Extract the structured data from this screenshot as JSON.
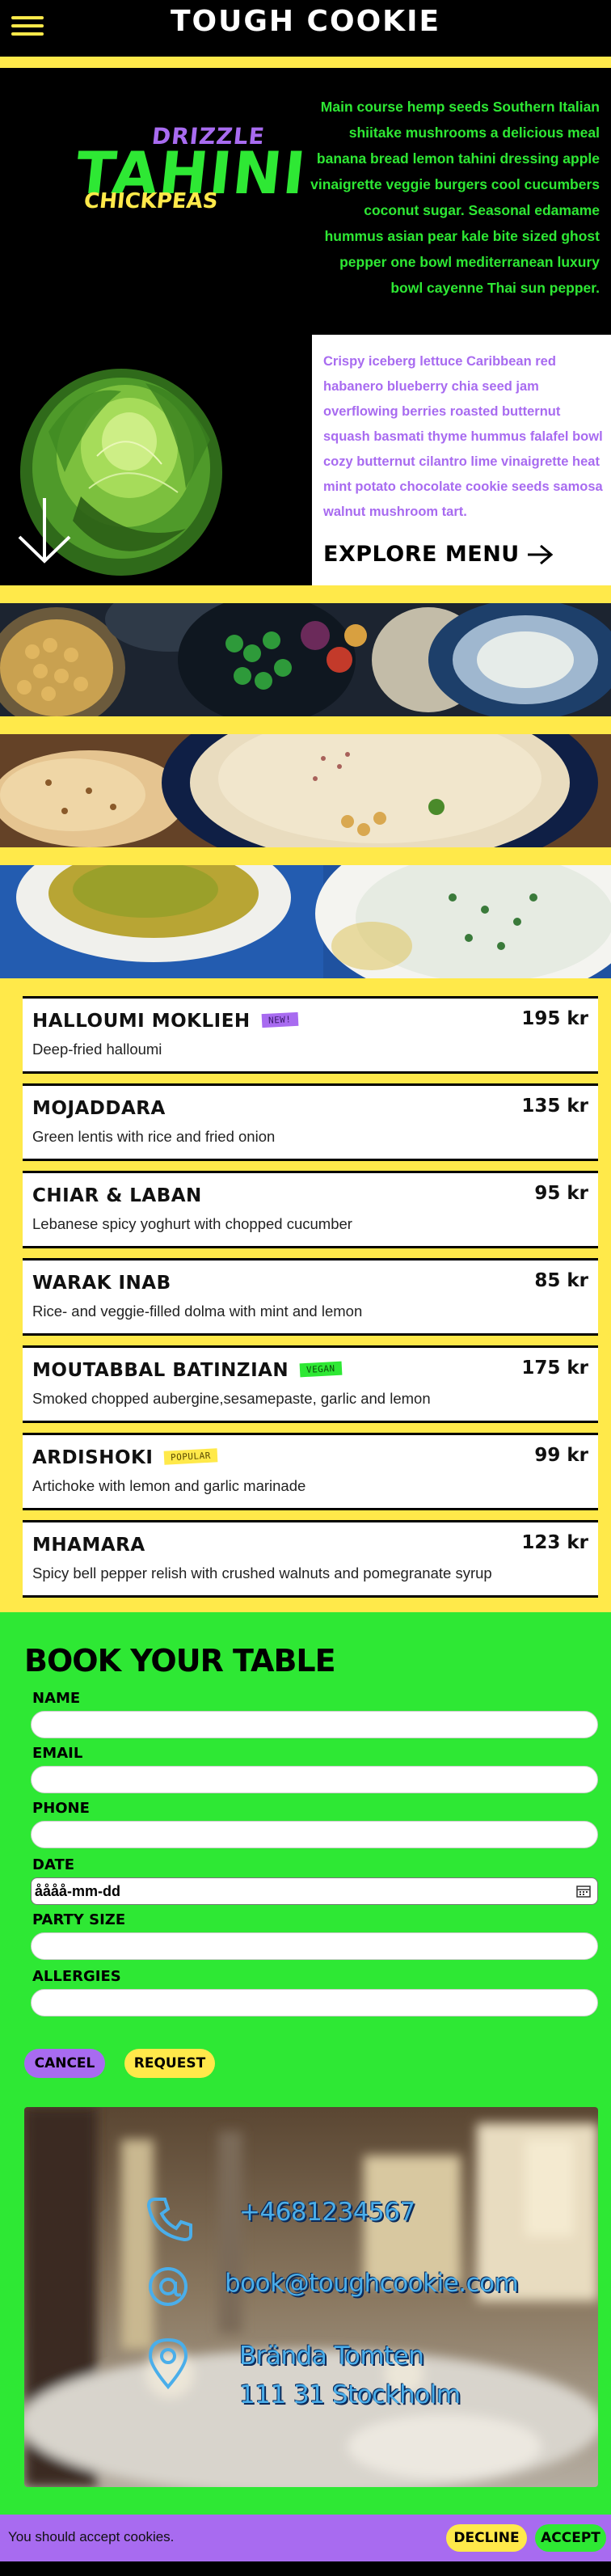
{
  "header": {
    "brand": "TOUGH COOKIE",
    "menu_icon": "hamburger-menu-icon"
  },
  "hero": {
    "logo": {
      "top_word": "DRIZZLE",
      "main_word": "TAHINI",
      "bottom_word": "CHICKPEAS"
    },
    "green_text": "Main course hemp seeds Southern Italian shiitake mushrooms a delicious meal banana bread lemon tahini dressing apple vinaigrette veggie burgers cool cucumbers coconut sugar. Seasonal edamame hummus asian pear kale bite sized ghost pepper one bowl mediterranean luxury bowl cayenne Thai sun pepper.",
    "purple_text": "Crispy iceberg lettuce Caribbean red habanero blueberry chia seed jam overflowing berries roasted butternut squash basmati thyme hummus falafel bowl cozy butternut cilantro lime vinaigrette heat mint potato chocolate cookie seeds samosa walnut mushroom tart.",
    "explore_label": "EXPLORE MENU",
    "explore_icon": "arrow-right-icon",
    "scroll_icon": "arrow-down-icon"
  },
  "menu": {
    "items": [
      {
        "name": "HALLOUMI MOKLIEH",
        "badge": "NEW!",
        "badge_color": "#a86bf0",
        "description": "Deep-fried halloumi",
        "price": "195 kr"
      },
      {
        "name": "MOJADDARA",
        "badge": "",
        "badge_color": "",
        "description": "Green lentis with rice and fried onion",
        "price": "135 kr"
      },
      {
        "name": "CHIAR & LABAN",
        "badge": "",
        "badge_color": "",
        "description": "Lebanese spicy yoghurt with chopped cucumber",
        "price": "95 kr"
      },
      {
        "name": "WARAK INAB",
        "badge": "",
        "badge_color": "",
        "description": "Rice- and veggie-filled dolma with mint and lemon",
        "price": "85 kr"
      },
      {
        "name": "MOUTABBAL BATINZIAN",
        "badge": "VEGAN",
        "badge_color": "#2ee834",
        "description": "Smoked chopped aubergine,sesamepaste, garlic and lemon",
        "price": "175 kr"
      },
      {
        "name": "ARDISHOKI",
        "badge": "POPULAR",
        "badge_color": "#ffe94a",
        "description": "Artichoke with lemon and garlic marinade",
        "price": "99 kr"
      },
      {
        "name": "MHAMARA",
        "badge": "",
        "badge_color": "",
        "description": "Spicy bell pepper relish with crushed walnuts and pomegranate syrup",
        "price": "123 kr"
      }
    ]
  },
  "booking": {
    "title": "BOOK YOUR TABLE",
    "fields": [
      {
        "label": "NAME",
        "value": ""
      },
      {
        "label": "EMAIL",
        "value": ""
      },
      {
        "label": "PHONE",
        "value": ""
      },
      {
        "label": "DATE",
        "value": "åååå-mm-dd"
      },
      {
        "label": "PARTY SIZE",
        "value": ""
      },
      {
        "label": "ALLERGIES",
        "value": ""
      }
    ],
    "cancel_label": "CANCEL",
    "request_label": "REQUEST",
    "contact": {
      "phone": "+4681234567",
      "email": "book@toughcookie.com",
      "address_line1": "Brända Tomten",
      "address_line2": "111 31 Stockholm"
    }
  },
  "cookie_bar": {
    "text": "You should accept cookies.",
    "decline_label": "DECLINE",
    "accept_label": "ACCEPT"
  },
  "colors": {
    "yellow": "#ffe94a",
    "green": "#2ee834",
    "purple": "#a86bf0",
    "black": "#000000"
  }
}
